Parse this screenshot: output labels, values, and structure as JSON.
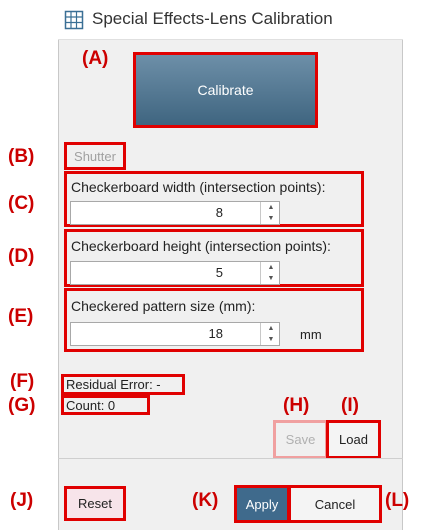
{
  "window": {
    "title": "Special Effects-Lens Calibration",
    "icon": "grid-table-icon"
  },
  "callouts": {
    "a": "(A)",
    "b": "(B)",
    "c": "(C)",
    "d": "(D)",
    "e": "(E)",
    "f": "(F)",
    "g": "(G)",
    "h": "(H)",
    "i": "(I)",
    "j": "(J)",
    "k": "(K)",
    "l": "(L)"
  },
  "calibrate": {
    "label": "Calibrate"
  },
  "shutter": {
    "label": "Shutter"
  },
  "checkerboard_width": {
    "label": "Checkerboard width (intersection points):",
    "value": "8"
  },
  "checkerboard_height": {
    "label": "Checkerboard height (intersection points):",
    "value": "5"
  },
  "pattern_size": {
    "label": "Checkered pattern size (mm):",
    "value": "18",
    "unit": "mm"
  },
  "status": {
    "residual_error": "Residual Error: -",
    "count": "Count: 0"
  },
  "buttons": {
    "save": "Save",
    "load": "Load",
    "reset": "Reset",
    "apply": "Apply",
    "cancel": "Cancel"
  },
  "colors": {
    "callout": "#cc0000",
    "calibrate_top": "#6d8fa8",
    "calibrate_bottom": "#3f6580",
    "apply_bg": "#3f6a8c",
    "reset_bg": "#f7e4ea"
  }
}
